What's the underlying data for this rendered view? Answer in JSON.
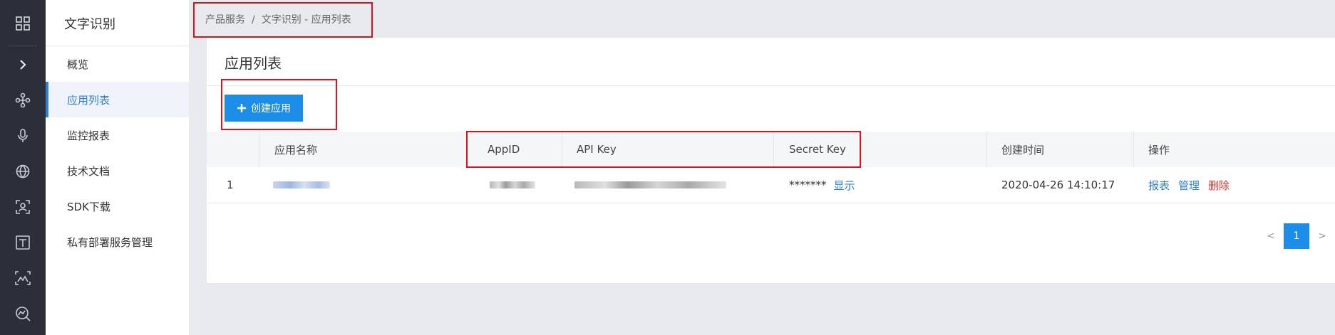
{
  "rail": {
    "icons": [
      "grid-icon",
      "chevron-right-icon",
      "nodes-icon",
      "microphone-icon",
      "globe-icon",
      "face-scan-icon",
      "text-t-icon",
      "image-scan-icon",
      "image-search-icon"
    ]
  },
  "sidebar": {
    "title": "文字识别",
    "items": [
      {
        "label": "概览"
      },
      {
        "label": "应用列表"
      },
      {
        "label": "监控报表"
      },
      {
        "label": "技术文档"
      },
      {
        "label": "SDK下载"
      },
      {
        "label": "私有部署服务管理"
      }
    ],
    "active_index": 1
  },
  "breadcrumb": {
    "root": "产品服务",
    "separator": "/",
    "current": "文字识别 - 应用列表"
  },
  "page": {
    "title": "应用列表",
    "create_button": "创建应用"
  },
  "table": {
    "headers": {
      "index": "",
      "name": "应用名称",
      "appid": "AppID",
      "api_key": "API Key",
      "secret_key": "Secret Key",
      "created": "创建时间",
      "ops": "操作"
    },
    "rows": [
      {
        "index": "1",
        "name": "[redacted]",
        "appid": "[redacted]",
        "api_key": "[redacted]",
        "secret_mask": "*******",
        "secret_show": "显示",
        "created": "2020-04-26 14:10:17",
        "op_report": "报表",
        "op_manage": "管理",
        "op_delete": "删除"
      }
    ]
  },
  "pagination": {
    "prev": "<",
    "current": "1",
    "next": ">"
  },
  "colors": {
    "rail_bg": "#2a2f3a",
    "accent": "#1c8de8",
    "link": "#2e7fd8",
    "danger": "#e8312a",
    "annotation": "#e0111b"
  }
}
